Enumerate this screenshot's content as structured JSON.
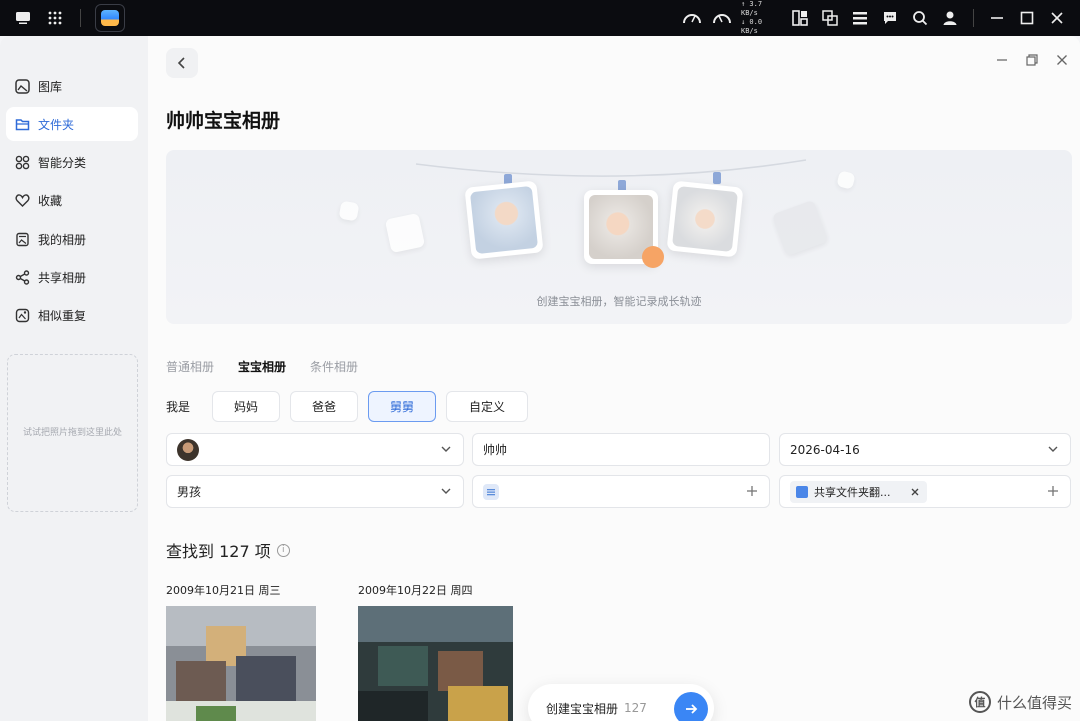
{
  "system_bar": {
    "net_up": "↑ 3.7 KB/s",
    "net_down": "↓ 0.0 KB/s",
    "gauges": [
      "cpu-gauge",
      "ram-gauge"
    ]
  },
  "sidebar": {
    "items": [
      {
        "label": "图库",
        "icon": "gallery-icon"
      },
      {
        "label": "文件夹",
        "icon": "folder-icon",
        "active": true
      },
      {
        "label": "智能分类",
        "icon": "grid-icon"
      },
      {
        "label": "收藏",
        "icon": "heart-icon"
      },
      {
        "label": "我的相册",
        "icon": "album-icon"
      },
      {
        "label": "共享相册",
        "icon": "share-icon"
      },
      {
        "label": "相似重复",
        "icon": "duplicate-icon"
      }
    ],
    "drop_hint": "试试把照片拖到这里此处"
  },
  "main": {
    "title": "帅帅宝宝相册",
    "banner_caption": "创建宝宝相册，智能记录成长轨迹",
    "tabs": [
      {
        "label": "普通相册"
      },
      {
        "label": "宝宝相册",
        "active": true
      },
      {
        "label": "条件相册"
      }
    ],
    "role_label": "我是",
    "roles": [
      {
        "label": "妈妈"
      },
      {
        "label": "爸爸"
      },
      {
        "label": "舅舅",
        "active": true
      },
      {
        "label": "自定义"
      }
    ],
    "form": {
      "person_value": "",
      "name_value": "帅帅",
      "birth_date": "2026-04-16",
      "gender_value": "男孩",
      "tag_value": "",
      "folder_chip": "共享文件夹翻..."
    },
    "result_count": "查找到 127 项",
    "groups": [
      {
        "date": "2009年10月21日 周三"
      },
      {
        "date": "2009年10月22日 周四"
      }
    ],
    "create_button": {
      "label": "创建宝宝相册",
      "count": "127"
    }
  },
  "watermark": "什么值得买",
  "colors": {
    "accent": "#3a86f5",
    "active_text": "#2f6bd8",
    "topbar": "#0b0c10"
  }
}
